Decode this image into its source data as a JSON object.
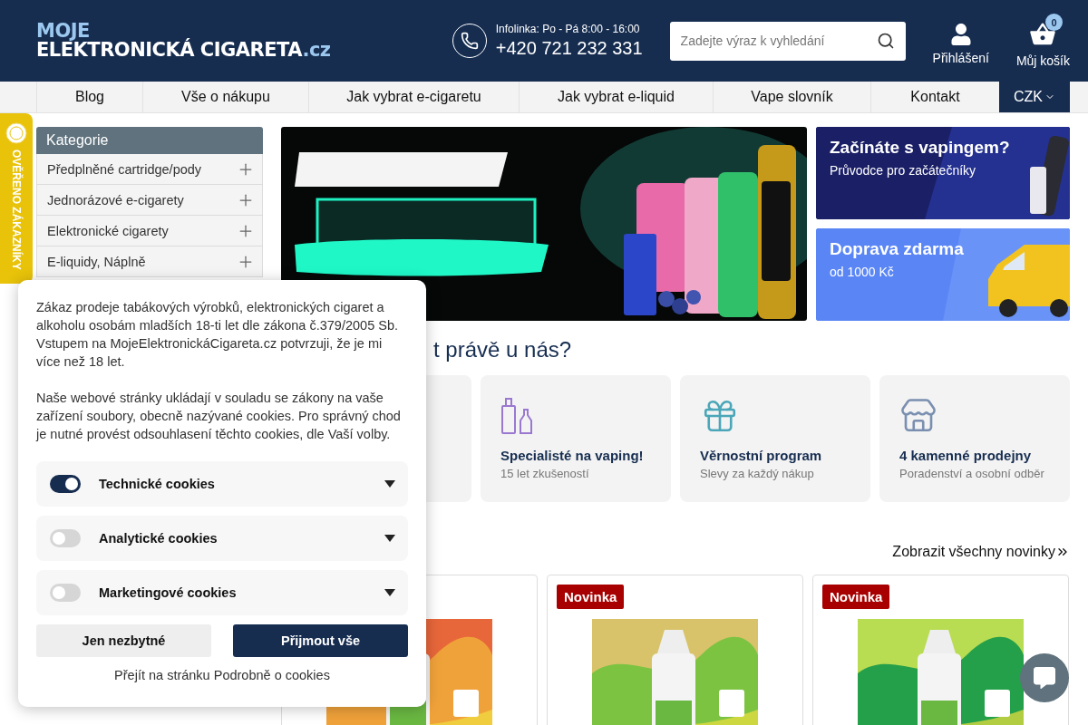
{
  "header": {
    "logo": {
      "prefix": "MOJE",
      "name": "ELEKTRONICKÁ CIGARETA",
      "tld": ".cz"
    },
    "hotline": {
      "label": "Infolinka: Po - Pá 8:00 - 16:00",
      "phone": "+420 721 232 331"
    },
    "search": {
      "placeholder": "Zadejte výraz k vyhledání"
    },
    "account": {
      "label": "Přihlášení"
    },
    "cart": {
      "label": "Můj košík",
      "count": "0"
    }
  },
  "nav": {
    "items": [
      {
        "label": "Blog"
      },
      {
        "label": "Vše o nákupu"
      },
      {
        "label": "Jak vybrat e-cigaretu"
      },
      {
        "label": "Jak vybrat e-liquid"
      },
      {
        "label": "Vape slovník"
      },
      {
        "label": "Kontakt"
      }
    ],
    "currency": {
      "label": "CZK"
    }
  },
  "trust_badge": {
    "label": "OVĚŘENO ZÁKAZNÍKY"
  },
  "sidebar": {
    "title": "Kategorie",
    "items": [
      {
        "label": "Předplněné cartridge/pody"
      },
      {
        "label": "Jednorázové e-cigarety"
      },
      {
        "label": "Elektronické cigarety"
      },
      {
        "label": "E-liquidy, Náplně"
      }
    ]
  },
  "hero": {
    "kind": "picture"
  },
  "promo_banners": [
    {
      "title": "Začínáte s vapingem?",
      "subtitle": "Průvodce pro začátečníky",
      "kind": "device"
    },
    {
      "title": "Doprava zdarma",
      "subtitle": "od 1000 Kč",
      "kind": "van"
    }
  ],
  "section_heading": "t právě u nás?",
  "features": [
    {
      "title": "Specialisté na vaping!",
      "subtitle": "15 let zkušeností",
      "kind": "bottles"
    },
    {
      "title": "Věrnostní program",
      "subtitle": "Slevy za každý nákup",
      "kind": "gift"
    },
    {
      "title": "4 kamenné prodejny",
      "subtitle": "Poradenství a osobní odběr",
      "kind": "store"
    }
  ],
  "news": {
    "link": "Zobrazit všechny novinky",
    "products": [
      {
        "kind": "picture"
      },
      {
        "kind": "picture",
        "badge": "Novinka"
      },
      {
        "kind": "picture",
        "badge": "Novinka"
      }
    ]
  },
  "cookie_dialog": {
    "paragraphs": [
      "Zákaz prodeje tabákových výrobků, elektronických cigaret a alkoholu osobám mladších 18-ti let dle zákona č.379/2005 Sb. Vstupem na MojeElektronickáCigareta.cz potvrzuji, že je mi více než 18 let.",
      "Naše webové stránky ukládají v souladu se zákony na vaše zařízení soubory, obecně nazývané cookies. Pro správný chod je nutné provést odsouhlasení těchto cookies, dle Vaší volby."
    ],
    "categories": [
      {
        "label": "Technické cookies",
        "on": true
      },
      {
        "label": "Analytické cookies",
        "on": false
      },
      {
        "label": "Marketingové cookies",
        "on": false
      }
    ],
    "buttons": [
      {
        "label": "Jen nezbytné",
        "kind": "secondary"
      },
      {
        "label": "Přijmout vše",
        "kind": "primary"
      }
    ],
    "link": "Přejít na stránku Podrobně o cookies"
  }
}
